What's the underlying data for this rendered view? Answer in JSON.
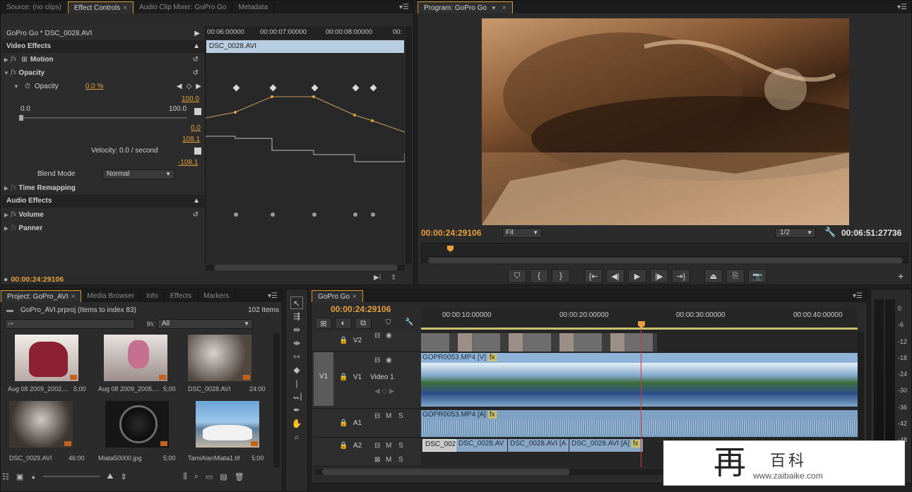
{
  "effect_panel": {
    "tabs": [
      "Source: (no clips)",
      "Effect Controls",
      "Audio Clip Mixer: GoPro Go",
      "Metadata"
    ],
    "active_tab_close": "×",
    "clip_title": "GoPro Go * DSC_0028.AVI",
    "timecodes": [
      "00:06:00000",
      "00:00:07:00000",
      "00:00:08:00000",
      "00:"
    ],
    "clip_bar": "DSC_0028.AVI",
    "video_effects": "Video Effects",
    "motion": "Motion",
    "opacity": "Opacity",
    "opacity_param": "Opacity",
    "opacity_value": "0.0 %",
    "val_100_top": "100.0",
    "val_min": "0.0",
    "val_max": "100.0",
    "val_0_bot": "0.0",
    "vel_top": "108.1",
    "velocity": "Velocity: 0.0 / second",
    "vel_bot": "-108.1",
    "blend_mode_label": "Blend Mode",
    "blend_mode_value": "Normal",
    "time_remapping": "Time Remapping",
    "audio_effects": "Audio Effects",
    "volume": "Volume",
    "panner": "Panner",
    "timecode": "00:00:24:29106",
    "fx_symbol": "fx"
  },
  "program": {
    "title": "Program: GoPro Go",
    "timecode": "00:00:24:29106",
    "fit": "Fit",
    "resolution": "1/2",
    "duration": "00:06:51:27736",
    "controls": [
      "marker",
      "mark-in",
      "mark-out",
      "go-to-in",
      "step-back",
      "play",
      "step-forward",
      "go-to-out",
      "lift",
      "extract",
      "export-frame"
    ],
    "add": "+"
  },
  "project": {
    "tabs": [
      "Project: GoPro_AVI",
      "Media Browser",
      "Info",
      "Effects",
      "Markers"
    ],
    "file": "GoPro_AVI.prproj (Items to index 83)",
    "count": "102 Items",
    "in_label": "In:",
    "in_value": "All",
    "items": [
      {
        "name": "Aug 08 2009_2002....",
        "dur": "5;00"
      },
      {
        "name": "Aug 08 2009_2005....",
        "dur": "5;00"
      },
      {
        "name": "DSC_0028.AVI",
        "dur": "24:00"
      },
      {
        "name": "DSC_0029.AVI",
        "dur": "46:00"
      },
      {
        "name": "Miata50000.jpg",
        "dur": "5;00"
      },
      {
        "name": "TamiAlanMiata1.tif",
        "dur": "5;00"
      }
    ]
  },
  "timeline": {
    "tab": "GoPro Go",
    "timecode": "00:00:24:29106",
    "ruler": [
      "00:00:10:00000",
      "00:00:20:00000",
      "00:00:30:00000",
      "00:00:40:00000"
    ],
    "tracks": {
      "v2": "V2",
      "v1_src": "V1",
      "v1": "V1",
      "video1": "Video 1",
      "a1": "A1",
      "a2": "A2",
      "m": "M",
      "s": "S"
    },
    "clips": {
      "v1_clip": "GOPR0053.MP4 [V]",
      "a1_clip": "GOPR0053.MP4 [A]",
      "a2_1": "DSC_002",
      "a2_2": "DSC_0028.AV",
      "a2_3": "DSC_0028.AVI [A",
      "a2_4": "DSC_0028.AVI [A]",
      "fx_badge": "fx"
    }
  },
  "meter": {
    "labels": [
      "0",
      "-6",
      "-12",
      "-18",
      "-24",
      "-30",
      "-36",
      "-42",
      "-48"
    ]
  },
  "watermark": {
    "char": "再",
    "brand": "百科",
    "url": "www.zaibaike.com"
  }
}
